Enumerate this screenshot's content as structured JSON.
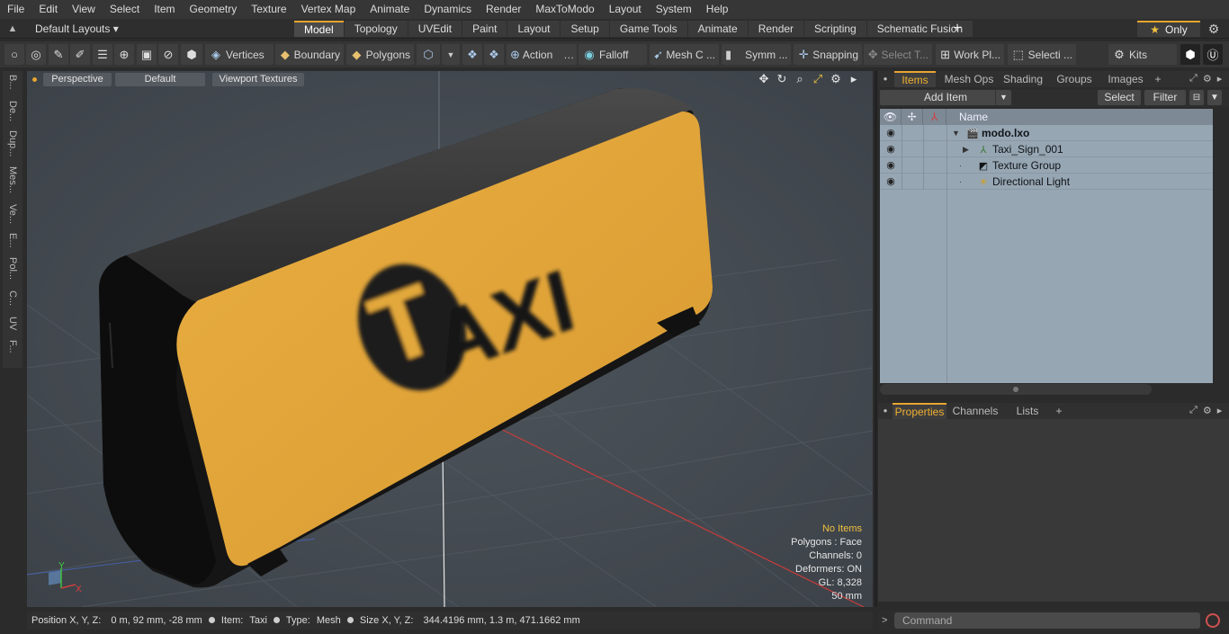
{
  "menu": [
    "File",
    "Edit",
    "View",
    "Select",
    "Item",
    "Geometry",
    "Texture",
    "Vertex Map",
    "Animate",
    "Dynamics",
    "Render",
    "MaxToModo",
    "Layout",
    "System",
    "Help"
  ],
  "layouts_label": "Default Layouts",
  "layout_tabs": [
    "Model",
    "Topology",
    "UVEdit",
    "Paint",
    "Layout",
    "Setup",
    "Game Tools",
    "Animate",
    "Render",
    "Scripting",
    "Schematic Fusion"
  ],
  "active_layout_tab": "Model",
  "only_label": "Only",
  "toolbar": {
    "vertices": "Vertices",
    "boundary": "Boundary",
    "polygons": "Polygons",
    "action": "Action",
    "falloff": "Falloff",
    "mesh": "Mesh C ...",
    "symm": "Symm ...",
    "snapping": "Snapping",
    "select_t": "Select T...",
    "work_pl": "Work Pl...",
    "selecti": "Selecti ...",
    "kits": "Kits"
  },
  "left_tabs": [
    "B...",
    "De...",
    "Dup...",
    "Mes...",
    "Ve...",
    "E...",
    "Pol...",
    "C...",
    "UV",
    "F..."
  ],
  "viewport": {
    "perspective": "Perspective",
    "default": "Default",
    "textures": "Viewport Textures",
    "sign_text": "AXI",
    "sign_logo_letter": "T",
    "info": {
      "no_items": "No Items",
      "polygons": "Polygons : Face",
      "channels": "Channels: 0",
      "deformers": "Deformers: ON",
      "gl": "GL: 8,328",
      "scale": "50 mm"
    },
    "axis_y": "Y",
    "axis_x": "X"
  },
  "status": {
    "position_label": "Position X, Y, Z:",
    "position_value": "0 m, 92 mm, -28 mm",
    "item_label": "Item:",
    "item_value": "Taxi",
    "type_label": "Type:",
    "type_value": "Mesh",
    "size_label": "Size X, Y, Z:",
    "size_value": "344.4196 mm, 1.3 m, 471.1662 mm"
  },
  "items_panel": {
    "tabs": [
      "Items",
      "Mesh Ops",
      "Shading",
      "Groups",
      "Images"
    ],
    "active_tab": "Items",
    "add_item": "Add Item",
    "select": "Select",
    "filter": "Filter",
    "name_header": "Name",
    "rows": [
      {
        "name": "modo.lxo",
        "icon": "scene-icon"
      },
      {
        "name": "Taxi_Sign_001",
        "icon": "mesh-item-icon"
      },
      {
        "name": "Texture Group",
        "icon": "texture-group-icon"
      },
      {
        "name": "Directional Light",
        "icon": "light-icon"
      }
    ]
  },
  "properties_panel": {
    "tabs": [
      "Properties",
      "Channels",
      "Lists"
    ],
    "active_tab": "Properties"
  },
  "command": {
    "placeholder": "Command"
  },
  "colors": {
    "accent": "#e8a530",
    "sign_yellow": "#e3a83a",
    "viewport_bg": "#454b52",
    "item_list_bg": "#97a6b3"
  }
}
